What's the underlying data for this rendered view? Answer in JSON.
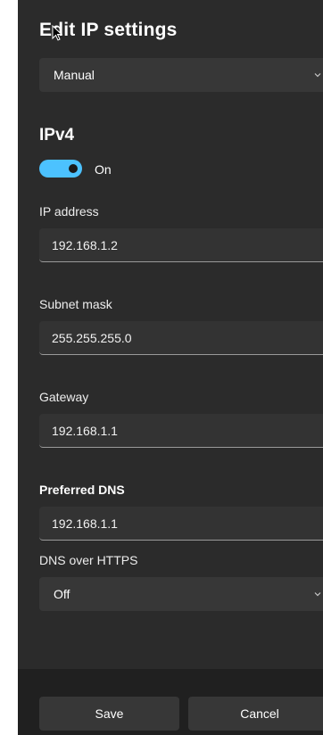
{
  "dialog": {
    "title": "Edit IP settings",
    "mode_dropdown": {
      "value": "Manual",
      "icon": "chevron-down-icon"
    }
  },
  "ipv4": {
    "heading": "IPv4",
    "toggle": {
      "state": "On",
      "on": true,
      "accent": "#4cc2ff"
    },
    "ip_address": {
      "label": "IP address",
      "value": "192.168.1.2"
    },
    "subnet_mask": {
      "label": "Subnet mask",
      "value": "255.255.255.0"
    },
    "gateway": {
      "label": "Gateway",
      "value": "192.168.1.1"
    },
    "preferred_dns": {
      "label": "Preferred DNS",
      "value": "192.168.1.1"
    },
    "dns_over_https": {
      "label": "DNS over HTTPS",
      "value": "Off",
      "icon": "chevron-down-icon"
    }
  },
  "footer": {
    "save_label": "Save",
    "cancel_label": "Cancel"
  }
}
